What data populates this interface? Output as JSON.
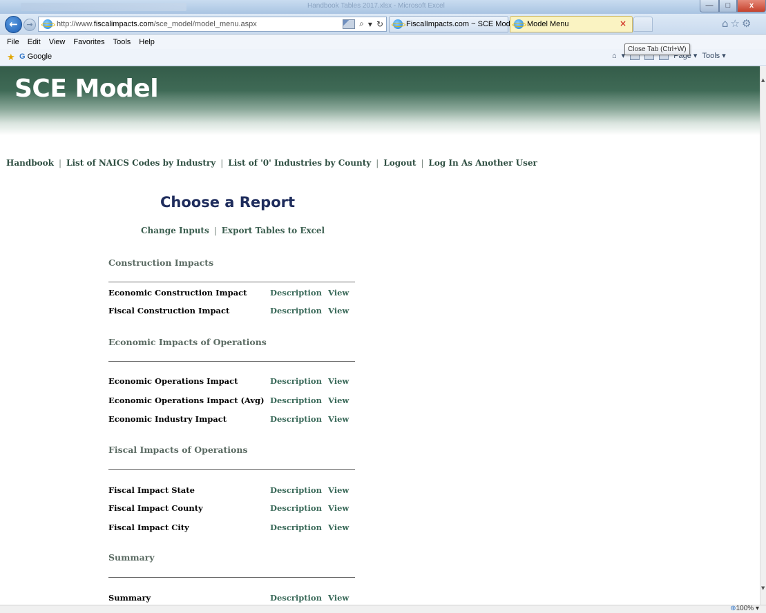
{
  "browser": {
    "faded_title": "Handbook Tables 2017.xlsx - Microsoft Excel",
    "window_controls": {
      "minimize": "—",
      "maximize": "□",
      "close": "x"
    },
    "url": {
      "prefix": "http://www.",
      "domain": "fiscalimpacts.com",
      "path": "/sce_model/model_menu.aspx"
    },
    "address_icons": {
      "search": "⌕",
      "dropdown": "▾",
      "refresh": "↻"
    },
    "tabs": [
      {
        "label": "FiscalImpacts.com ~ SCE Model",
        "active": false
      },
      {
        "label": "Model Menu",
        "active": true,
        "close": "×"
      }
    ],
    "right_icons": "⌂☆⚙",
    "menu": [
      "File",
      "Edit",
      "View",
      "Favorites",
      "Tools",
      "Help"
    ],
    "favorites": {
      "star": "★",
      "g": "G",
      "label": "Google"
    },
    "command_bar": {
      "home_arrow": "▾",
      "page": "Page ▾",
      "tools": "Tools ▾"
    },
    "tooltip": "Close Tab (Ctrl+W)",
    "zoom": "100%",
    "zoom_icon": "⊕",
    "zoom_arrow": "▾"
  },
  "site": {
    "title": "SCE Model"
  },
  "top_nav": [
    "Handbook",
    "List of NAICS Codes by Industry",
    "List of '0' Industries by County",
    "Logout",
    "Log In As Another User"
  ],
  "separator": "|",
  "report": {
    "title": "Choose a Report",
    "sub_nav": [
      "Change Inputs",
      "Export Tables to Excel"
    ]
  },
  "link_labels": {
    "description": "Description",
    "view": "View"
  },
  "sections": [
    {
      "heading": "Construction Impacts",
      "items": [
        "Economic Construction Impact",
        "Fiscal Construction Impact"
      ]
    },
    {
      "heading": "Economic Impacts of Operations",
      "items": [
        "Economic Operations Impact",
        "Economic Operations Impact (Avg)",
        "Economic Industry Impact"
      ]
    },
    {
      "heading": "Fiscal Impacts of Operations",
      "items": [
        "Fiscal Impact State",
        "Fiscal Impact County",
        "Fiscal Impact City"
      ]
    },
    {
      "heading": "Summary",
      "items": [
        "Summary"
      ]
    }
  ],
  "colors": {
    "header_green": "#345c49",
    "title_navy": "#1e2c5c",
    "link_green": "#3b6a5a"
  }
}
